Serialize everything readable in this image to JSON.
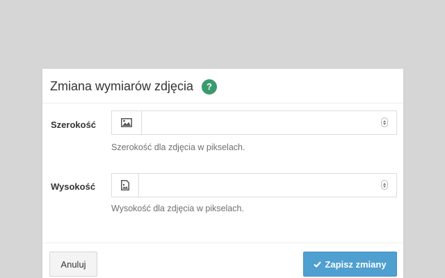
{
  "modal": {
    "title": "Zmiana wymiarów zdjęcia",
    "help_icon": "question-mark-icon",
    "help_glyph": "?"
  },
  "fields": [
    {
      "label": "Szerokość",
      "icon": "image-icon",
      "value": "",
      "help": "Szerokość dla zdjęcia w pikselach."
    },
    {
      "label": "Wysokość",
      "icon": "image-file-icon",
      "value": "",
      "help": "Wysokość dla zdjęcia w pikselach."
    }
  ],
  "footer": {
    "cancel_label": "Anuluj",
    "save_label": "Zapisz zmiany",
    "save_icon": "check-icon"
  },
  "colors": {
    "backdrop": "#d6d6d6",
    "help_badge": "#3a9a6e",
    "primary": "#4f9fd1"
  }
}
